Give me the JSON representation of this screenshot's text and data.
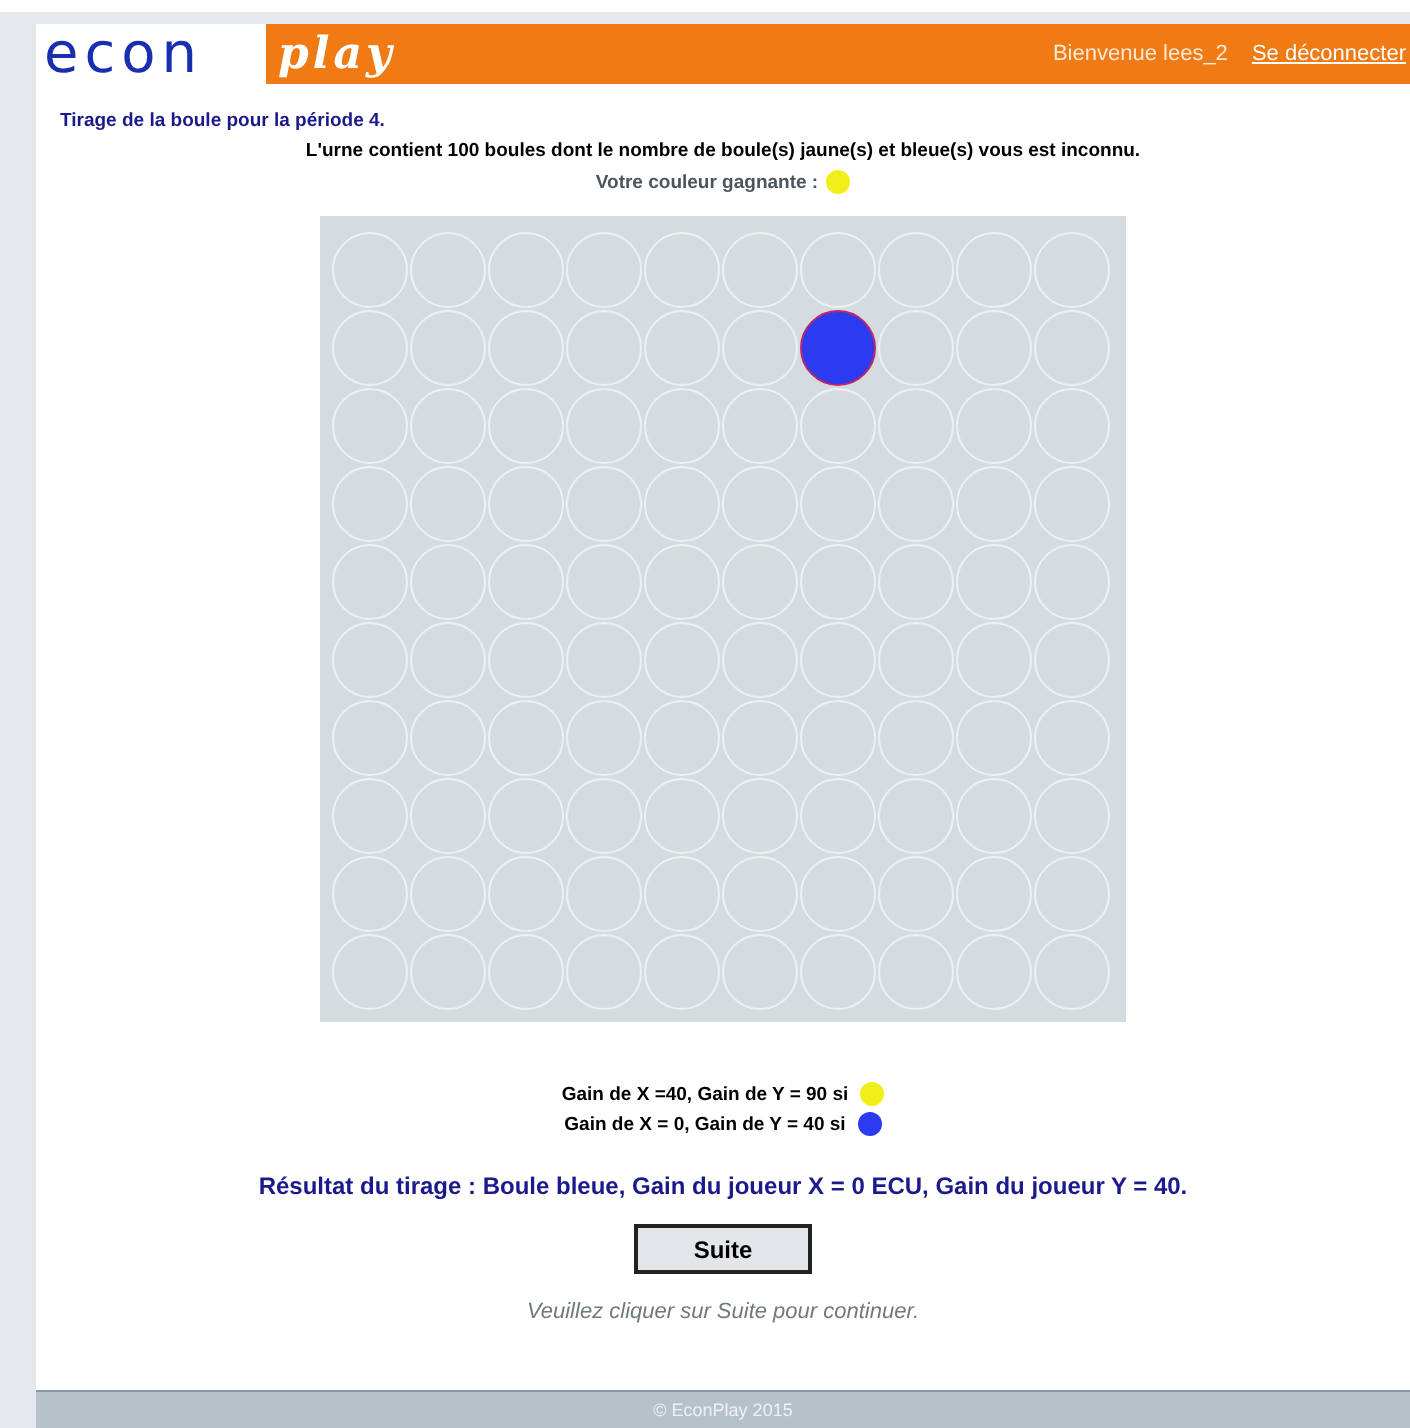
{
  "header": {
    "logo_left": "econ",
    "logo_right": "play",
    "welcome": "Bienvenue lees_2",
    "logout": "Se déconnecter"
  },
  "title": "Tirage de la boule pour la période 4.",
  "intro": "L'urne contient 100 boules dont le nombre de boule(s) jaune(s) et bleue(s) vous est inconnu.",
  "winning": {
    "label": "Votre couleur gagnante :",
    "color": "#f2ee1a"
  },
  "urn": [
    {
      "balls": [
        {
          "drawn": false
        },
        {
          "drawn": false
        },
        {
          "drawn": false
        },
        {
          "drawn": false
        },
        {
          "drawn": false
        },
        {
          "drawn": false
        },
        {
          "drawn": false
        },
        {
          "drawn": false
        },
        {
          "drawn": false
        },
        {
          "drawn": false
        }
      ]
    },
    {
      "balls": [
        {
          "drawn": false
        },
        {
          "drawn": false
        },
        {
          "drawn": false
        },
        {
          "drawn": false
        },
        {
          "drawn": false
        },
        {
          "drawn": false
        },
        {
          "drawn": true,
          "color": "#2a3bf0"
        },
        {
          "drawn": false
        },
        {
          "drawn": false
        },
        {
          "drawn": false
        }
      ]
    },
    {
      "balls": [
        {
          "drawn": false
        },
        {
          "drawn": false
        },
        {
          "drawn": false
        },
        {
          "drawn": false
        },
        {
          "drawn": false
        },
        {
          "drawn": false
        },
        {
          "drawn": false
        },
        {
          "drawn": false
        },
        {
          "drawn": false
        },
        {
          "drawn": false
        }
      ]
    },
    {
      "balls": [
        {
          "drawn": false
        },
        {
          "drawn": false
        },
        {
          "drawn": false
        },
        {
          "drawn": false
        },
        {
          "drawn": false
        },
        {
          "drawn": false
        },
        {
          "drawn": false
        },
        {
          "drawn": false
        },
        {
          "drawn": false
        },
        {
          "drawn": false
        }
      ]
    },
    {
      "balls": [
        {
          "drawn": false
        },
        {
          "drawn": false
        },
        {
          "drawn": false
        },
        {
          "drawn": false
        },
        {
          "drawn": false
        },
        {
          "drawn": false
        },
        {
          "drawn": false
        },
        {
          "drawn": false
        },
        {
          "drawn": false
        },
        {
          "drawn": false
        }
      ]
    },
    {
      "balls": [
        {
          "drawn": false
        },
        {
          "drawn": false
        },
        {
          "drawn": false
        },
        {
          "drawn": false
        },
        {
          "drawn": false
        },
        {
          "drawn": false
        },
        {
          "drawn": false
        },
        {
          "drawn": false
        },
        {
          "drawn": false
        },
        {
          "drawn": false
        }
      ]
    },
    {
      "balls": [
        {
          "drawn": false
        },
        {
          "drawn": false
        },
        {
          "drawn": false
        },
        {
          "drawn": false
        },
        {
          "drawn": false
        },
        {
          "drawn": false
        },
        {
          "drawn": false
        },
        {
          "drawn": false
        },
        {
          "drawn": false
        },
        {
          "drawn": false
        }
      ]
    },
    {
      "balls": [
        {
          "drawn": false
        },
        {
          "drawn": false
        },
        {
          "drawn": false
        },
        {
          "drawn": false
        },
        {
          "drawn": false
        },
        {
          "drawn": false
        },
        {
          "drawn": false
        },
        {
          "drawn": false
        },
        {
          "drawn": false
        },
        {
          "drawn": false
        }
      ]
    },
    {
      "balls": [
        {
          "drawn": false
        },
        {
          "drawn": false
        },
        {
          "drawn": false
        },
        {
          "drawn": false
        },
        {
          "drawn": false
        },
        {
          "drawn": false
        },
        {
          "drawn": false
        },
        {
          "drawn": false
        },
        {
          "drawn": false
        },
        {
          "drawn": false
        }
      ]
    },
    {
      "balls": [
        {
          "drawn": false
        },
        {
          "drawn": false
        },
        {
          "drawn": false
        },
        {
          "drawn": false
        },
        {
          "drawn": false
        },
        {
          "drawn": false
        },
        {
          "drawn": false
        },
        {
          "drawn": false
        },
        {
          "drawn": false
        },
        {
          "drawn": false
        }
      ]
    }
  ],
  "legend": [
    {
      "text": "Gain de X =40, Gain de Y = 90 si",
      "color": "#f2ee1a"
    },
    {
      "text": "Gain de X = 0, Gain de Y = 40 si",
      "color": "#2a3bf0"
    }
  ],
  "result": "Résultat du tirage : Boule bleue, Gain du joueur X = 0 ECU, Gain du joueur Y = 40.",
  "button": "Suite",
  "hint": "Veuillez cliquer sur Suite pour continuer.",
  "footer": "© EconPlay 2015"
}
